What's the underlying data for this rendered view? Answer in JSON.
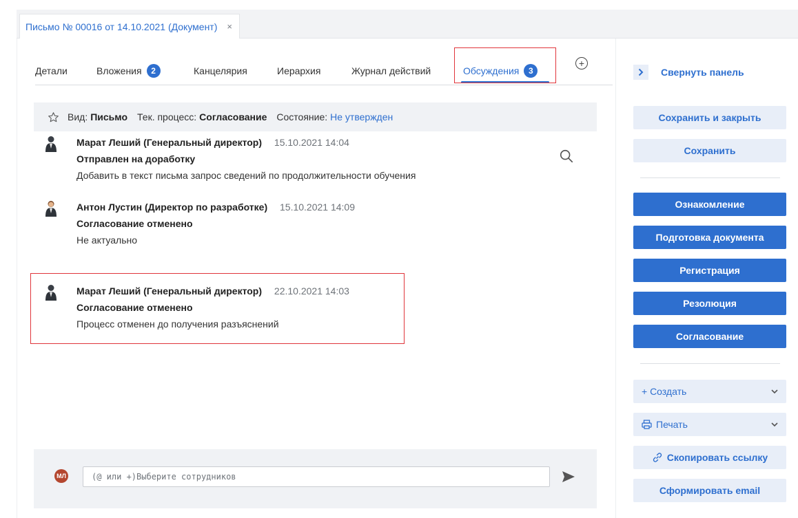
{
  "document_tab": {
    "title": "Письмо № 00016 от 14.10.2021 (Документ)",
    "close": "×"
  },
  "nav": {
    "tabs": [
      {
        "label": "Детали"
      },
      {
        "label": "Вложения",
        "badge": "2"
      },
      {
        "label": "Канцелярия"
      },
      {
        "label": "Иерархия"
      },
      {
        "label": "Журнал действий"
      },
      {
        "label": "Обсуждения",
        "badge": "3",
        "active": true
      }
    ],
    "add_icon": "plus-circle-icon"
  },
  "info": {
    "kind_label": "Вид:",
    "kind_value": "Письмо",
    "process_label": "Тек. процесс:",
    "process_value": "Согласование",
    "state_label": "Состояние:",
    "state_value": "Не утвержден"
  },
  "comments": [
    {
      "author": "Марат Леший (Генеральный директор)",
      "date": "15.10.2021 14:04",
      "status": "Отправлен на доработку",
      "text": "Добавить в текст письма запрос сведений по продолжительности обучения"
    },
    {
      "author": "Антон Лустин (Директор по разработке)",
      "date": "15.10.2021 14:09",
      "status": "Согласование отменено",
      "text": "Не актуально"
    },
    {
      "author": "Марат Леший (Генеральный директор)",
      "date": "22.10.2021 14:03",
      "status": "Согласование отменено",
      "text": "Процесс отменен до получения разъяснений"
    }
  ],
  "composer": {
    "avatar_initials": "МЛ",
    "placeholder": "(@ или +)Выберите сотрудников",
    "value": ""
  },
  "side": {
    "collapse_label": "Свернуть панель",
    "save_close": "Сохранить и закрыть",
    "save": "Сохранить",
    "processes": [
      "Ознакомление",
      "Подготовка документа",
      "Регистрация",
      "Резолюция",
      "Согласование"
    ],
    "create": "+ Создать",
    "print": "Печать",
    "copy_link": "Скопировать ссылку",
    "email": "Сформировать email"
  },
  "colors": {
    "accent": "#2e6fcf",
    "highlight": "#e0343a",
    "panel_bg": "#f0f2f5"
  }
}
